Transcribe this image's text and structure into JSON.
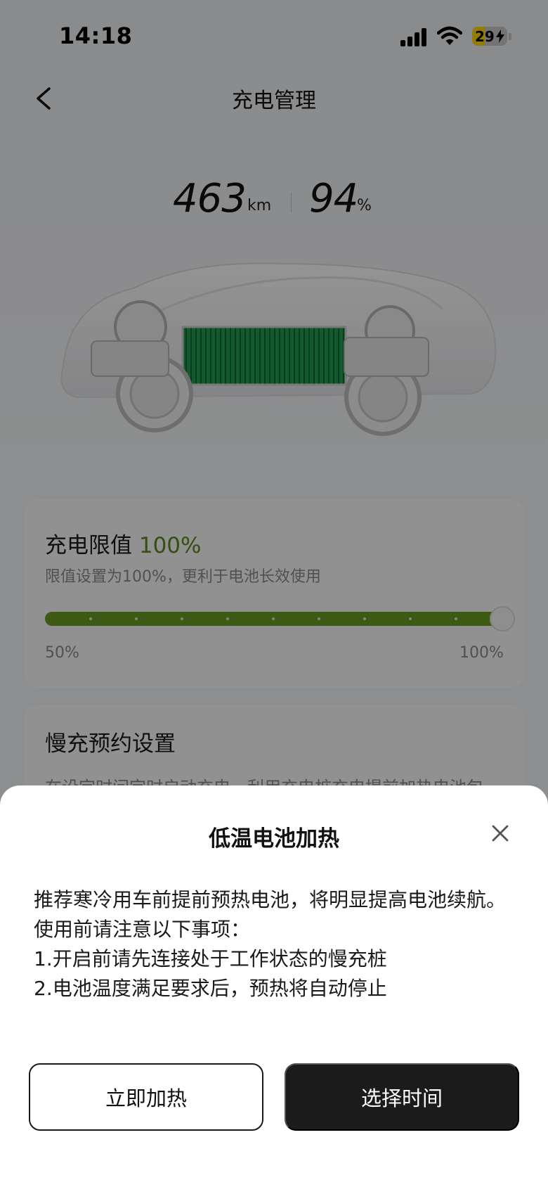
{
  "status_bar": {
    "time": "14:18",
    "battery_level": "29"
  },
  "nav": {
    "title": "充电管理",
    "back_icon": "chevron-left-icon"
  },
  "range": {
    "distance_value": "463",
    "distance_unit": "km",
    "soc_value": "94",
    "soc_unit": "%"
  },
  "charge_limit": {
    "title": "充电限值",
    "value": "100%",
    "subtitle": "限值设置为100%，更利于电池长效使用",
    "slider_min_label": "50%",
    "slider_max_label": "100%",
    "slider_level": 1.0
  },
  "slow_charge": {
    "title": "慢充预约设置",
    "subtitle": "在设定时间定时启动充电，利用充电桩充电提前加热电池包"
  },
  "sheet": {
    "title": "低温电池加热",
    "close_icon": "close-icon",
    "body_lines": [
      "推荐寒冷用车前提前预热电池，将明显提高电池续航。使用前请注意以下事项：",
      "1.开启前请先连接处于工作状态的慢充桩",
      "2.电池温度满足要求后，预热将自动停止"
    ],
    "primary_button": "选择时间",
    "secondary_button": "立即加热"
  },
  "colors": {
    "accent_green": "#5b8a1d",
    "battery_green": "#1f9a4f",
    "status_battery_yellow": "#ffd60a"
  }
}
